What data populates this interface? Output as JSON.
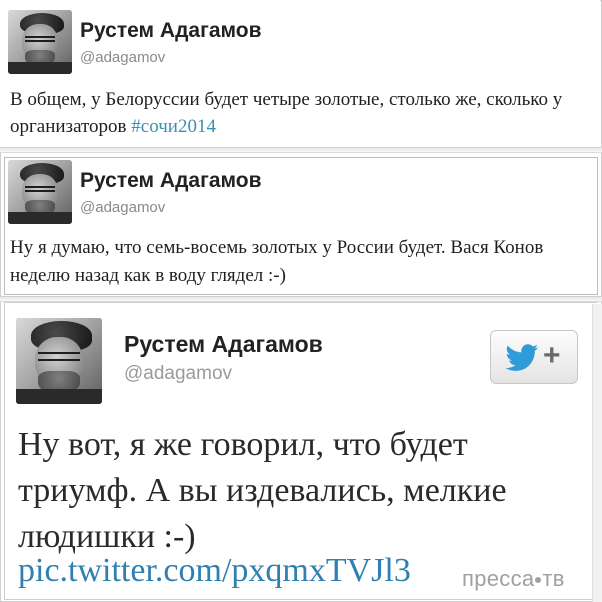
{
  "tweets": [
    {
      "name": "Рустем Адагамов",
      "handle": "@adagamov",
      "text": "В общем, у Белоруссии будет четыре золотые, столько же, сколько у организаторов ",
      "hashtag": "#сочи2014"
    },
    {
      "name": "Рустем Адагамов",
      "handle": "@adagamov",
      "text": "Ну я думаю, что семь-восемь золотых у России будет. Вася Конов неделю назад как в воду глядел :-)"
    },
    {
      "name": "Рустем Адагамов",
      "handle": "@adagamov",
      "text": "Ну вот, я же говорил, что будет триумф. А вы издевались, мелкие людишки :-)",
      "link": "pic.twitter.com/pxqmxTVJl3"
    }
  ],
  "follow_button": {
    "icon": "twitter-bird-icon",
    "label": "+"
  },
  "watermark": {
    "left": "пресса",
    "right": "тв"
  },
  "colors": {
    "hashtag": "#3a8fb8",
    "link": "#2f80b0",
    "handle": "#8a8a8a",
    "twitter_blue": "#2f9bd8"
  }
}
